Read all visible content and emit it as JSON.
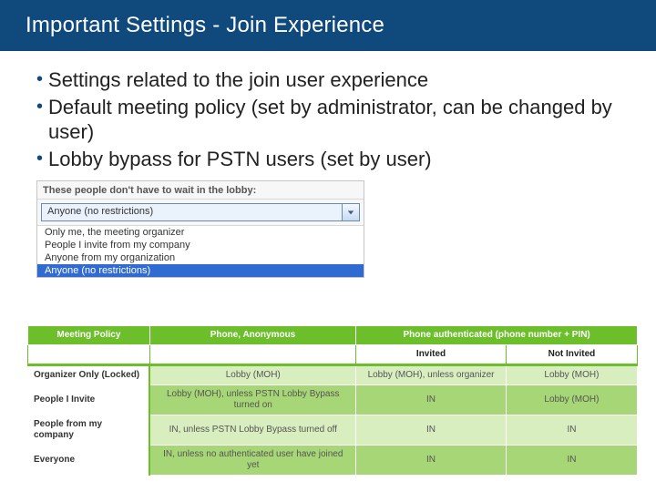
{
  "title": "Important Settings - Join Experience",
  "bullets": [
    "Settings related to the join user experience",
    "Default meeting policy (set by administrator, can be changed by user)",
    "Lobby bypass for PSTN users (set by user)"
  ],
  "dropdown": {
    "label": "These people don't have to wait in the lobby:",
    "selected": "Anyone (no restrictions)",
    "options": [
      "Only me, the meeting organizer",
      "People I invite from my company",
      "Anyone from my organization",
      "Anyone (no restrictions)"
    ],
    "highlightedIndex": "3"
  },
  "chart_data": {
    "type": "table",
    "title": "Meeting Policy lobby behavior",
    "columns": [
      "Meeting Policy",
      "Phone, Anonymous",
      "Phone authenticated (phone number + PIN) – Invited",
      "Phone authenticated (phone number + PIN) – Not Invited"
    ],
    "rows": [
      [
        "Organizer Only (Locked)",
        "Lobby (MOH)",
        "Lobby (MOH), unless organizer",
        "Lobby (MOH)"
      ],
      [
        "People I Invite",
        "Lobby (MOH), unless PSTN Lobby Bypass turned on",
        "IN",
        "Lobby (MOH)"
      ],
      [
        "People from my company",
        "IN, unless PSTN Lobby Bypass turned off",
        "IN",
        "IN"
      ],
      [
        "Everyone",
        "IN, unless no authenticated user have joined yet",
        "IN",
        "IN"
      ]
    ]
  },
  "table": {
    "hdr": {
      "col1": "Meeting Policy",
      "col2": "Phone, Anonymous",
      "col3span": "Phone authenticated (phone number + PIN)",
      "sub_inv": "Invited",
      "sub_ninv": "Not Invited"
    },
    "rows": [
      {
        "label": "Organizer Only (Locked)",
        "pa": "Lobby (MOH)",
        "inv": "Lobby (MOH), unless organizer",
        "ninv": "Lobby (MOH)"
      },
      {
        "label": "People I Invite",
        "pa": "Lobby (MOH), unless PSTN Lobby Bypass turned on",
        "inv": "IN",
        "ninv": "Lobby (MOH)"
      },
      {
        "label": "People from my company",
        "pa": "IN, unless PSTN Lobby Bypass turned off",
        "inv": "IN",
        "ninv": "IN"
      },
      {
        "label": "Everyone",
        "pa": "IN, unless no authenticated user have joined yet",
        "inv": "IN",
        "ninv": "IN"
      }
    ]
  }
}
